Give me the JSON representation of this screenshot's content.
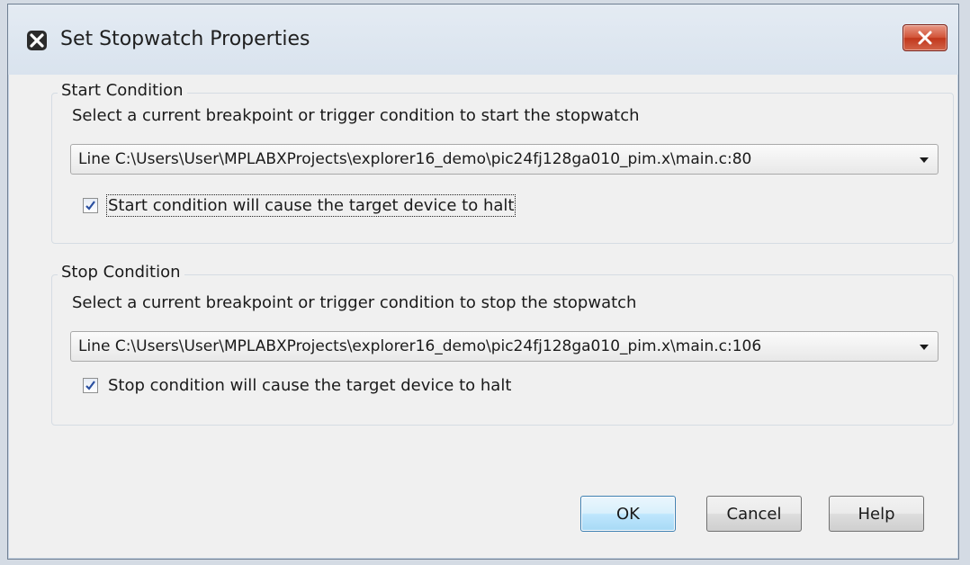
{
  "window": {
    "title": "Set Stopwatch Properties"
  },
  "start": {
    "group_title": "Start Condition",
    "description": "Select a current breakpoint or trigger condition to start the stopwatch",
    "selected": "Line C:\\Users\\User\\MPLABXProjects\\explorer16_demo\\pic24fj128ga010_pim.x\\main.c:80",
    "halt_label": "Start condition will cause the target device to halt",
    "halt_checked": true
  },
  "stop": {
    "group_title": "Stop Condition",
    "description": "Select a current breakpoint or trigger condition to stop the stopwatch",
    "selected": "Line C:\\Users\\User\\MPLABXProjects\\explorer16_demo\\pic24fj128ga010_pim.x\\main.c:106",
    "halt_label": "Stop condition will cause the target device to halt",
    "halt_checked": true
  },
  "buttons": {
    "ok": "OK",
    "cancel": "Cancel",
    "help": "Help"
  },
  "icons": {
    "app": "mplab-x-icon",
    "close": "close-icon",
    "dropdown": "chevron-down-icon",
    "check": "checkmark-icon"
  },
  "colors": {
    "close_button": "#c8452a",
    "default_button_border": "#3c7fb1",
    "checkmark": "#2a4fa0"
  }
}
